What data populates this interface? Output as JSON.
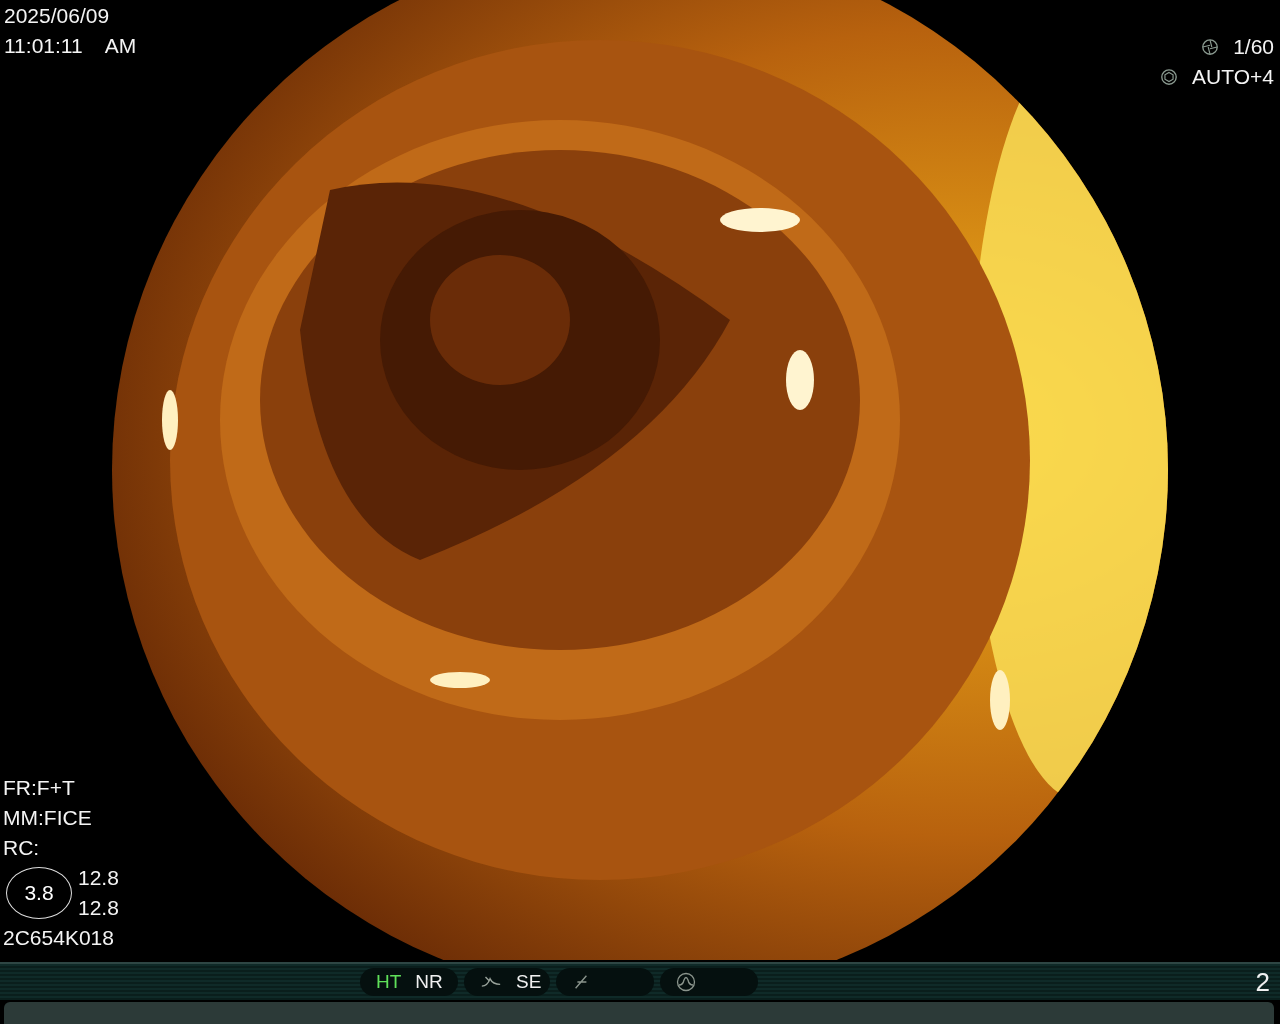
{
  "datetime": {
    "date": "2025/06/09",
    "time": "11:01:11",
    "meridiem": "AM"
  },
  "exposure": {
    "shutter": "1/60",
    "iris": "AUTO+4"
  },
  "settings": [
    "FR:F+T",
    "MM:FICE",
    "RC:"
  ],
  "gauge": {
    "value": "3.8",
    "readings": [
      "12.8",
      "12.8"
    ]
  },
  "scope_id": "2C654K018",
  "status_bar": {
    "groups": [
      {
        "kind": "text",
        "items": [
          {
            "label": "HT",
            "active": true
          },
          {
            "label": "NR",
            "active": false
          }
        ]
      },
      {
        "kind": "curve",
        "items": [
          {
            "label": "SE",
            "active": false
          }
        ]
      },
      {
        "kind": "slash"
      },
      {
        "kind": "wave"
      }
    ],
    "page": "2"
  }
}
